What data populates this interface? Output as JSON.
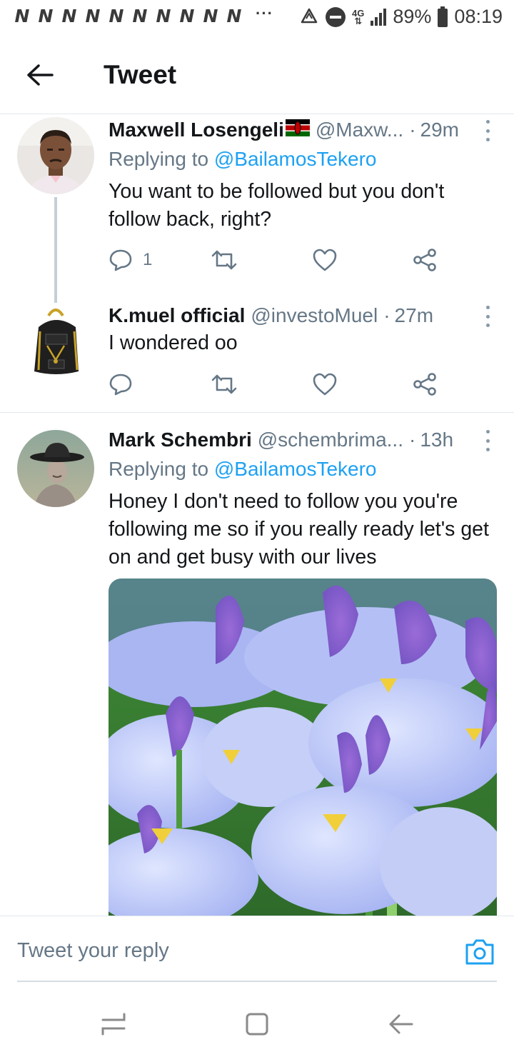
{
  "status_bar": {
    "notification_icons": [
      "N",
      "N",
      "N",
      "N",
      "N",
      "N",
      "N",
      "N",
      "N",
      "N"
    ],
    "more": "···",
    "network_top": "4G",
    "battery": "89%",
    "time": "08:19"
  },
  "header": {
    "title": "Tweet"
  },
  "tweets": [
    {
      "name": "Maxwell Losengeli",
      "handle": "@Maxw...",
      "time": "29m",
      "replying_to_label": "Replying to",
      "replying_to": "@BailamosTekero",
      "text": "You want to be followed but you don't follow back, right?",
      "reply_count": "1"
    },
    {
      "name": "K.muel official",
      "handle": "@investoMuel",
      "time": "27m",
      "text": "I wondered oo"
    },
    {
      "name": "Mark Schembri",
      "handle": "@schembrima...",
      "time": "13h",
      "replying_to_label": "Replying to",
      "replying_to": "@BailamosTekero",
      "text": "Honey I don't need to follow you you're following me so if you really ready let's get on and get busy with our lives"
    }
  ],
  "composer": {
    "placeholder": "Tweet your reply"
  },
  "colors": {
    "link": "#1da1f2",
    "muted": "#657786",
    "text": "#14171a",
    "divider": "#e1e8ed"
  },
  "icons": [
    "back-arrow-icon",
    "reply-icon",
    "retweet-icon",
    "like-icon",
    "share-icon",
    "more-icon",
    "camera-icon",
    "recents-icon",
    "home-icon",
    "nav-back-icon"
  ]
}
